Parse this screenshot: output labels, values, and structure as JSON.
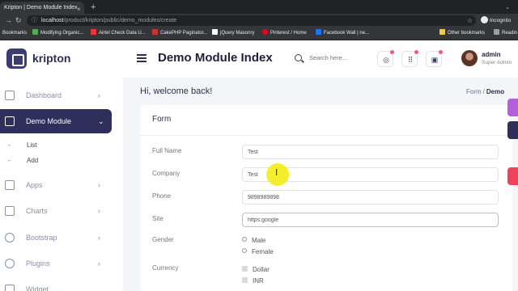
{
  "browser": {
    "tab_title": "Kripton | Demo Module Index",
    "tab_close": "×",
    "new_tab": "+",
    "tab_menu": "⌄",
    "url_host": "localhost",
    "url_path": "/product/kripton/public/demo_modules/create",
    "incognito_label": "Incognito",
    "bookmarks": [
      {
        "label": "Bookmarks",
        "color": "#35363a"
      },
      {
        "label": "Modifying Organic...",
        "color": "#4caf50"
      },
      {
        "label": "Airtel Check Data U...",
        "color": "#e53935"
      },
      {
        "label": "CakePHP Paginator...",
        "color": "#d32f2f"
      },
      {
        "label": "jQuery Masonry",
        "color": "#ffffff"
      },
      {
        "label": "Pinterest / Home",
        "color": "#e60023"
      },
      {
        "label": "Facebook Wall | ne...",
        "color": "#1877f2"
      },
      {
        "label": "Other bookmarks",
        "color": "#f9c74f"
      },
      {
        "label": "Readin",
        "color": "#9aa0a6"
      }
    ]
  },
  "app": {
    "logo_text": "kripton",
    "page_title": "Demo Module Index",
    "search_placeholder": "Search here...",
    "user_name": "admin",
    "user_role": "Super Admin",
    "welcome": "Hi, welcome back!",
    "breadcrumb": {
      "link": "Form",
      "sep": "/",
      "current": "Demo"
    }
  },
  "sidebar": {
    "items": [
      {
        "label": "Dashboard",
        "chevron": "›"
      },
      {
        "label": "Demo Module",
        "chevron": "⌄"
      },
      {
        "label": "Apps",
        "chevron": "›"
      },
      {
        "label": "Charts",
        "chevron": "›"
      },
      {
        "label": "Bootstrap",
        "chevron": "›"
      },
      {
        "label": "Plugins",
        "chevron": "›"
      },
      {
        "label": "Widget",
        "chevron": ""
      }
    ],
    "sub_items": [
      {
        "dash": "-",
        "label": "List"
      },
      {
        "dash": "-",
        "label": "Add"
      }
    ]
  },
  "form": {
    "title": "Form",
    "fields": [
      {
        "label": "Full Name",
        "value": "Test"
      },
      {
        "label": "Company",
        "value": "Test"
      },
      {
        "label": "Phone",
        "value": "9898989898"
      },
      {
        "label": "Site",
        "value": "https:google"
      }
    ],
    "gender": {
      "label": "Gender",
      "options": [
        "Male",
        "Female"
      ]
    },
    "currency": {
      "label": "Currency",
      "options": [
        "Dollar",
        "INR"
      ]
    }
  },
  "colors": {
    "sidebar_active": "#2e305b",
    "notification_dot": "#f05a7e",
    "cursor_highlight": "#f5eb14"
  }
}
